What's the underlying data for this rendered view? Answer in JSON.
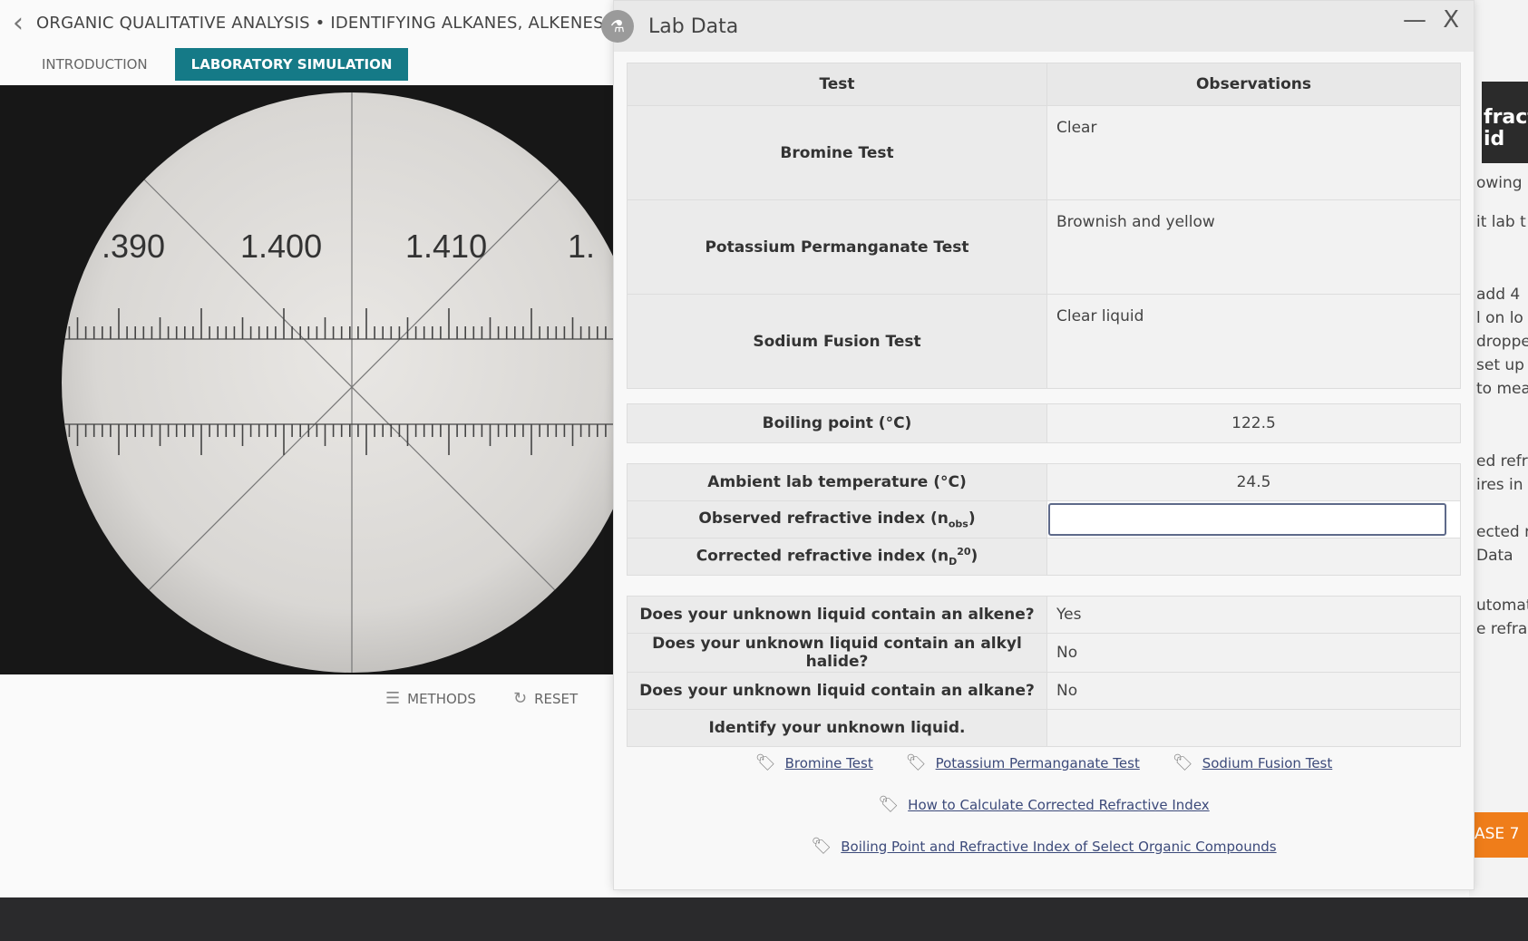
{
  "header": {
    "title": "ORGANIC QUALITATIVE ANALYSIS • IDENTIFYING ALKANES, ALKENES,",
    "tabs": [
      {
        "label": "INTRODUCTION",
        "active": false
      },
      {
        "label": "LABORATORY SIMULATION",
        "active": true
      }
    ]
  },
  "scope": {
    "scale_labels": [
      ".390",
      "1.400",
      "1.410",
      "1."
    ]
  },
  "controls": {
    "methods": "METHODS",
    "reset": "RESET"
  },
  "modal": {
    "title": "Lab Data",
    "minimize": "—",
    "close": "X",
    "tests_table": {
      "headers": [
        "Test",
        "Observations"
      ],
      "rows": [
        {
          "test": "Bromine Test",
          "observation": "Clear"
        },
        {
          "test": "Potassium Permanganate Test",
          "observation": "Brownish and yellow"
        },
        {
          "test": "Sodium Fusion Test",
          "observation": "Clear liquid"
        }
      ]
    },
    "boiling_point": {
      "label": "Boiling point (°C)",
      "value": "122.5"
    },
    "refractive": {
      "ambient_label": "Ambient lab temperature (°C)",
      "ambient_value": "24.5",
      "nobs_label": "Observed refractive index (n",
      "nobs_sub": "obs",
      "nobs_value": "",
      "nd_label": "Corrected refractive index (n",
      "nd_sub": "D",
      "nd_sup": "20",
      "nd_value": ""
    },
    "questions": [
      {
        "q": "Does your unknown liquid contain an alkene?",
        "a": "Yes"
      },
      {
        "q": "Does your unknown liquid contain an alkyl halide?",
        "a": "No"
      },
      {
        "q": "Does your unknown liquid contain an alkane?",
        "a": "No"
      },
      {
        "q": "Identify your unknown liquid.",
        "a": ""
      }
    ],
    "links": {
      "bromine": "Bromine Test",
      "permanganate": "Potassium Permanganate Test",
      "sodium": "Sodium Fusion Test",
      "corrected": "How to Calculate Corrected Refractive Index",
      "boiling": "Boiling Point and Refractive Index of Select Organic Compounds"
    }
  },
  "background_panel": {
    "dark_text": "fracti\nid",
    "lines": [
      "owing",
      "it lab t",
      "add 4\nl on lo\ndroppe\nset up\nto mea",
      "ed refr\nires in",
      "ected r\nData",
      "utomat\ne refrac"
    ],
    "orange": "ASE 7"
  }
}
